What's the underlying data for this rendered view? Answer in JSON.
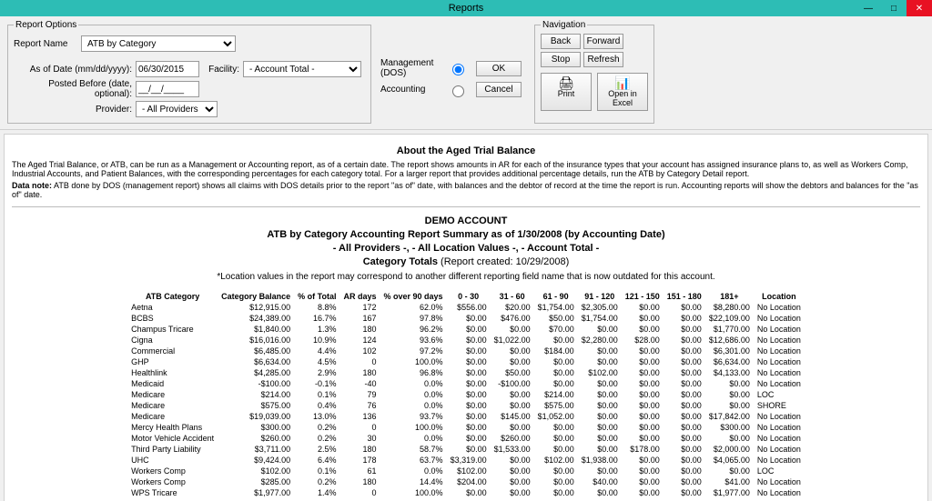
{
  "window": {
    "title": "Reports",
    "min": "—",
    "max": "□",
    "close": "✕"
  },
  "options": {
    "legend": "Report Options",
    "report_name_lbl": "Report Name",
    "report_name_val": "ATB by Category",
    "asof_lbl": "As of Date (mm/dd/yyyy):",
    "asof_val": "06/30/2015",
    "posted_lbl": "Posted Before (date, optional):",
    "posted_val": "__/__/____",
    "provider_lbl": "Provider:",
    "provider_val": "- All Providers -",
    "facility_lbl": "Facility:",
    "facility_val": "- Account Total -",
    "mgmt_lbl": "Management (DOS)",
    "acct_lbl": "Accounting",
    "ok": "OK",
    "cancel": "Cancel"
  },
  "nav": {
    "legend": "Navigation",
    "back": "Back",
    "forward": "Forward",
    "stop": "Stop",
    "refresh": "Refresh",
    "print": "Print",
    "excel": "Open in Excel",
    "print_icon": "🖨",
    "excel_icon": "📊"
  },
  "report": {
    "about_title": "About the Aged Trial Balance",
    "para1": "The Aged Trial Balance, or ATB, can be run as a Management or Accounting report, as of a certain date. The report shows amounts in AR for each of the insurance types that your account has assigned insurance plans to, as well as Workers Comp, Industrial Accounts, and Patient Balances, with the corresponding percentages for each category total. For a larger report that provides additional percentage details, run the ATB by Category Detail report.",
    "para2_lead": "Data note:",
    "para2": " ATB done by DOS (management report) shows all claims with DOS details prior to the report \"as of\" date, with balances and the debtor of record at the time the report is run. Accounting reports will show the debtors and balances for the \"as of\" date.",
    "h1": "DEMO ACCOUNT",
    "h2": "ATB by Category Accounting Report Summary as of 1/30/2008 (by Accounting Date)",
    "h3": "- All Providers -, - All Location Values -, - Account Total -",
    "h4a": "Category Totals",
    "h4b": " (Report created: 10/29/2008)",
    "note": "*Location values in the report may correspond to another different reporting field name that is now outdated for this account.",
    "cols": [
      "ATB Category",
      "Category Balance",
      "% of Total",
      "AR days",
      "% over 90 days",
      "0 - 30",
      "31 - 60",
      "61 - 90",
      "91 - 120",
      "121 - 150",
      "151 - 180",
      "181+",
      "Location"
    ],
    "rows": [
      [
        "Aetna",
        "$12,915.00",
        "8.8%",
        "172",
        "62.0%",
        "$556.00",
        "$20.00",
        "$1,754.00",
        "$2,305.00",
        "$0.00",
        "$0.00",
        "$8,280.00",
        "No Location"
      ],
      [
        "BCBS",
        "$24,389.00",
        "16.7%",
        "167",
        "97.8%",
        "$0.00",
        "$476.00",
        "$50.00",
        "$1,754.00",
        "$0.00",
        "$0.00",
        "$22,109.00",
        "No Location"
      ],
      [
        "Champus Tricare",
        "$1,840.00",
        "1.3%",
        "180",
        "96.2%",
        "$0.00",
        "$0.00",
        "$70.00",
        "$0.00",
        "$0.00",
        "$0.00",
        "$1,770.00",
        "No Location"
      ],
      [
        "Cigna",
        "$16,016.00",
        "10.9%",
        "124",
        "93.6%",
        "$0.00",
        "$1,022.00",
        "$0.00",
        "$2,280.00",
        "$28.00",
        "$0.00",
        "$12,686.00",
        "No Location"
      ],
      [
        "Commercial",
        "$6,485.00",
        "4.4%",
        "102",
        "97.2%",
        "$0.00",
        "$0.00",
        "$184.00",
        "$0.00",
        "$0.00",
        "$0.00",
        "$6,301.00",
        "No Location"
      ],
      [
        "GHP",
        "$6,634.00",
        "4.5%",
        "0",
        "100.0%",
        "$0.00",
        "$0.00",
        "$0.00",
        "$0.00",
        "$0.00",
        "$0.00",
        "$6,634.00",
        "No Location"
      ],
      [
        "Healthlink",
        "$4,285.00",
        "2.9%",
        "180",
        "96.8%",
        "$0.00",
        "$50.00",
        "$0.00",
        "$102.00",
        "$0.00",
        "$0.00",
        "$4,133.00",
        "No Location"
      ],
      [
        "Medicaid",
        "-$100.00",
        "-0.1%",
        "-40",
        "0.0%",
        "$0.00",
        "-$100.00",
        "$0.00",
        "$0.00",
        "$0.00",
        "$0.00",
        "$0.00",
        "No Location"
      ],
      [
        "Medicare",
        "$214.00",
        "0.1%",
        "79",
        "0.0%",
        "$0.00",
        "$0.00",
        "$214.00",
        "$0.00",
        "$0.00",
        "$0.00",
        "$0.00",
        "LOC"
      ],
      [
        "Medicare",
        "$575.00",
        "0.4%",
        "76",
        "0.0%",
        "$0.00",
        "$0.00",
        "$575.00",
        "$0.00",
        "$0.00",
        "$0.00",
        "$0.00",
        "SHORE"
      ],
      [
        "Medicare",
        "$19,039.00",
        "13.0%",
        "136",
        "93.7%",
        "$0.00",
        "$145.00",
        "$1,052.00",
        "$0.00",
        "$0.00",
        "$0.00",
        "$17,842.00",
        "No Location"
      ],
      [
        "Mercy Health Plans",
        "$300.00",
        "0.2%",
        "0",
        "100.0%",
        "$0.00",
        "$0.00",
        "$0.00",
        "$0.00",
        "$0.00",
        "$0.00",
        "$300.00",
        "No Location"
      ],
      [
        "Motor Vehicle Accident",
        "$260.00",
        "0.2%",
        "30",
        "0.0%",
        "$0.00",
        "$260.00",
        "$0.00",
        "$0.00",
        "$0.00",
        "$0.00",
        "$0.00",
        "No Location"
      ],
      [
        "Third Party Liability",
        "$3,711.00",
        "2.5%",
        "180",
        "58.7%",
        "$0.00",
        "$1,533.00",
        "$0.00",
        "$0.00",
        "$178.00",
        "$0.00",
        "$2,000.00",
        "No Location"
      ],
      [
        "UHC",
        "$9,424.00",
        "6.4%",
        "178",
        "63.7%",
        "$3,319.00",
        "$0.00",
        "$102.00",
        "$1,938.00",
        "$0.00",
        "$0.00",
        "$4,065.00",
        "No Location"
      ],
      [
        "Workers Comp",
        "$102.00",
        "0.1%",
        "61",
        "0.0%",
        "$102.00",
        "$0.00",
        "$0.00",
        "$0.00",
        "$0.00",
        "$0.00",
        "$0.00",
        "LOC"
      ],
      [
        "Workers Comp",
        "$285.00",
        "0.2%",
        "180",
        "14.4%",
        "$204.00",
        "$0.00",
        "$0.00",
        "$40.00",
        "$0.00",
        "$0.00",
        "$41.00",
        "No Location"
      ],
      [
        "WPS Tricare",
        "$1,977.00",
        "1.4%",
        "0",
        "100.0%",
        "$0.00",
        "$0.00",
        "$0.00",
        "$0.00",
        "$0.00",
        "$0.00",
        "$1,977.00",
        "No Location"
      ]
    ]
  }
}
